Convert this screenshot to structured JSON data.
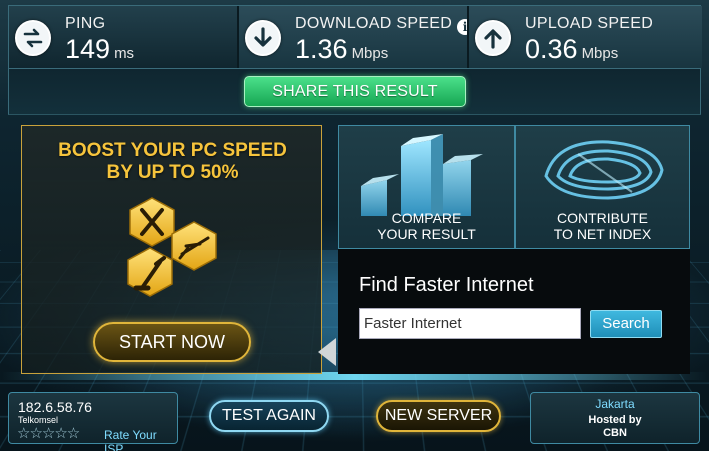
{
  "metrics": {
    "ping": {
      "label": "PING",
      "value": "149",
      "unit": "ms",
      "icon": "sync-arrows-icon"
    },
    "download": {
      "label": "DOWNLOAD SPEED",
      "value": "1.36",
      "unit": "Mbps",
      "icon": "arrow-down-icon"
    },
    "upload": {
      "label": "UPLOAD SPEED",
      "value": "0.36",
      "unit": "Mbps",
      "icon": "arrow-up-icon"
    }
  },
  "info_icon_glyph": "i",
  "share_label": "SHARE THIS RESULT",
  "boost": {
    "title_line1": "BOOST YOUR PC SPEED",
    "title_line2": "BY UP TO 50%",
    "button_label": "START NOW"
  },
  "tiles": {
    "compare_line1": "COMPARE",
    "compare_line2": "YOUR RESULT",
    "contribute_line1": "CONTRIBUTE",
    "contribute_line2": "TO NET INDEX"
  },
  "find": {
    "title": "Find Faster Internet",
    "input_value": "Faster Internet",
    "button_label": "Search"
  },
  "isp": {
    "ip": "182.6.58.76",
    "name": "Telkomsel",
    "stars": "☆☆☆☆☆",
    "rate_label": "Rate Your ISP"
  },
  "buttons": {
    "test_again": "TEST AGAIN",
    "new_server": "NEW SERVER"
  },
  "host": {
    "city": "Jakarta",
    "hosted_by": "Hosted by",
    "name": "CBN"
  },
  "colors": {
    "accent_green": "#1fb25c",
    "accent_gold": "#f6c43c",
    "accent_blue": "#3fb8df"
  }
}
